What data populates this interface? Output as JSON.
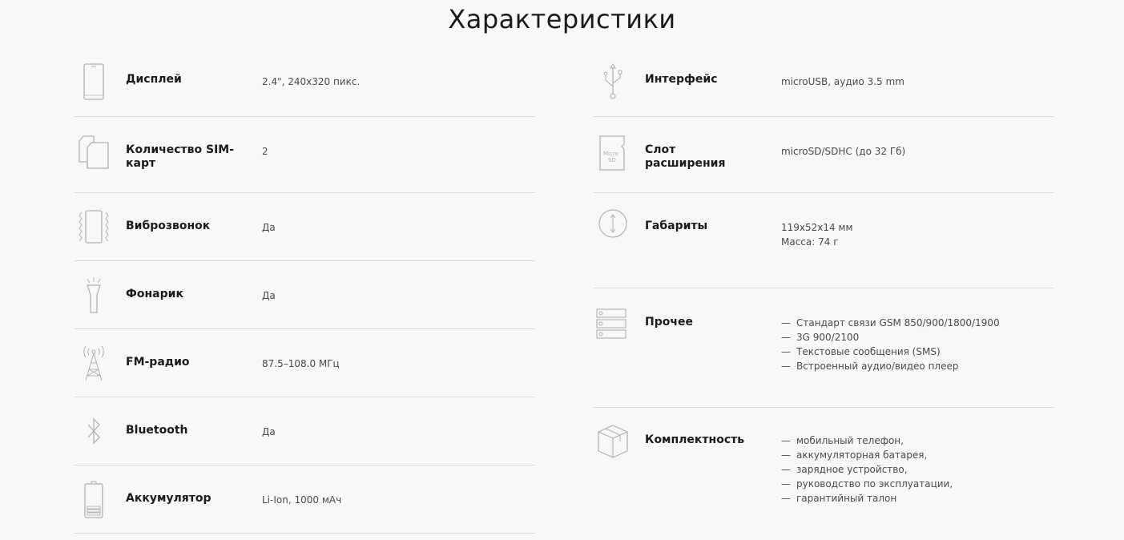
{
  "title": "Характеристики",
  "left": [
    {
      "icon": "phone-display-icon",
      "label": "Дисплей",
      "value": "2.4\", 240x320 пикс."
    },
    {
      "icon": "sim-cards-icon",
      "label": "Количество SIM-карт",
      "value": "2"
    },
    {
      "icon": "vibration-icon",
      "label": "Виброзвонок",
      "value": "Да"
    },
    {
      "icon": "flashlight-icon",
      "label": "Фонарик",
      "value": "Да"
    },
    {
      "icon": "radio-tower-icon",
      "label": "FM-радио",
      "value": "87.5–108.0 МГц"
    },
    {
      "icon": "bluetooth-icon",
      "label": "Bluetooth",
      "value": "Да"
    },
    {
      "icon": "battery-icon",
      "label": "Аккумулятор",
      "value": "Li-Ion, 1000 мАч"
    }
  ],
  "right": {
    "interface": {
      "icon": "usb-icon",
      "label": "Интерфейс",
      "value": "microUSB, аудио 3.5 mm"
    },
    "slot": {
      "icon": "microsd-card-icon",
      "label": "Слот расширения",
      "value": "microSD/SDHC (до 32 Гб)",
      "card_text_1": "Micro",
      "card_text_2": "SD"
    },
    "dimensions": {
      "icon": "dimensions-icon",
      "label": "Габариты",
      "value_1": "119x52x14 мм",
      "value_2": "Масса: 74 г"
    },
    "other": {
      "icon": "list-icon",
      "label": "Прочее",
      "items": [
        "Стандарт связи GSM 850/900/1800/1900",
        "3G 900/2100",
        "Текстовые сообщения (SMS)",
        "Встроенный аудио/видео плеер"
      ]
    },
    "package": {
      "icon": "box-icon",
      "label": "Комплектность",
      "items": [
        "мобильный телефон,",
        "аккумуляторная батарея,",
        "зарядное устройство,",
        "руководство по эксплуатации,",
        "гарантийный талон"
      ]
    }
  }
}
